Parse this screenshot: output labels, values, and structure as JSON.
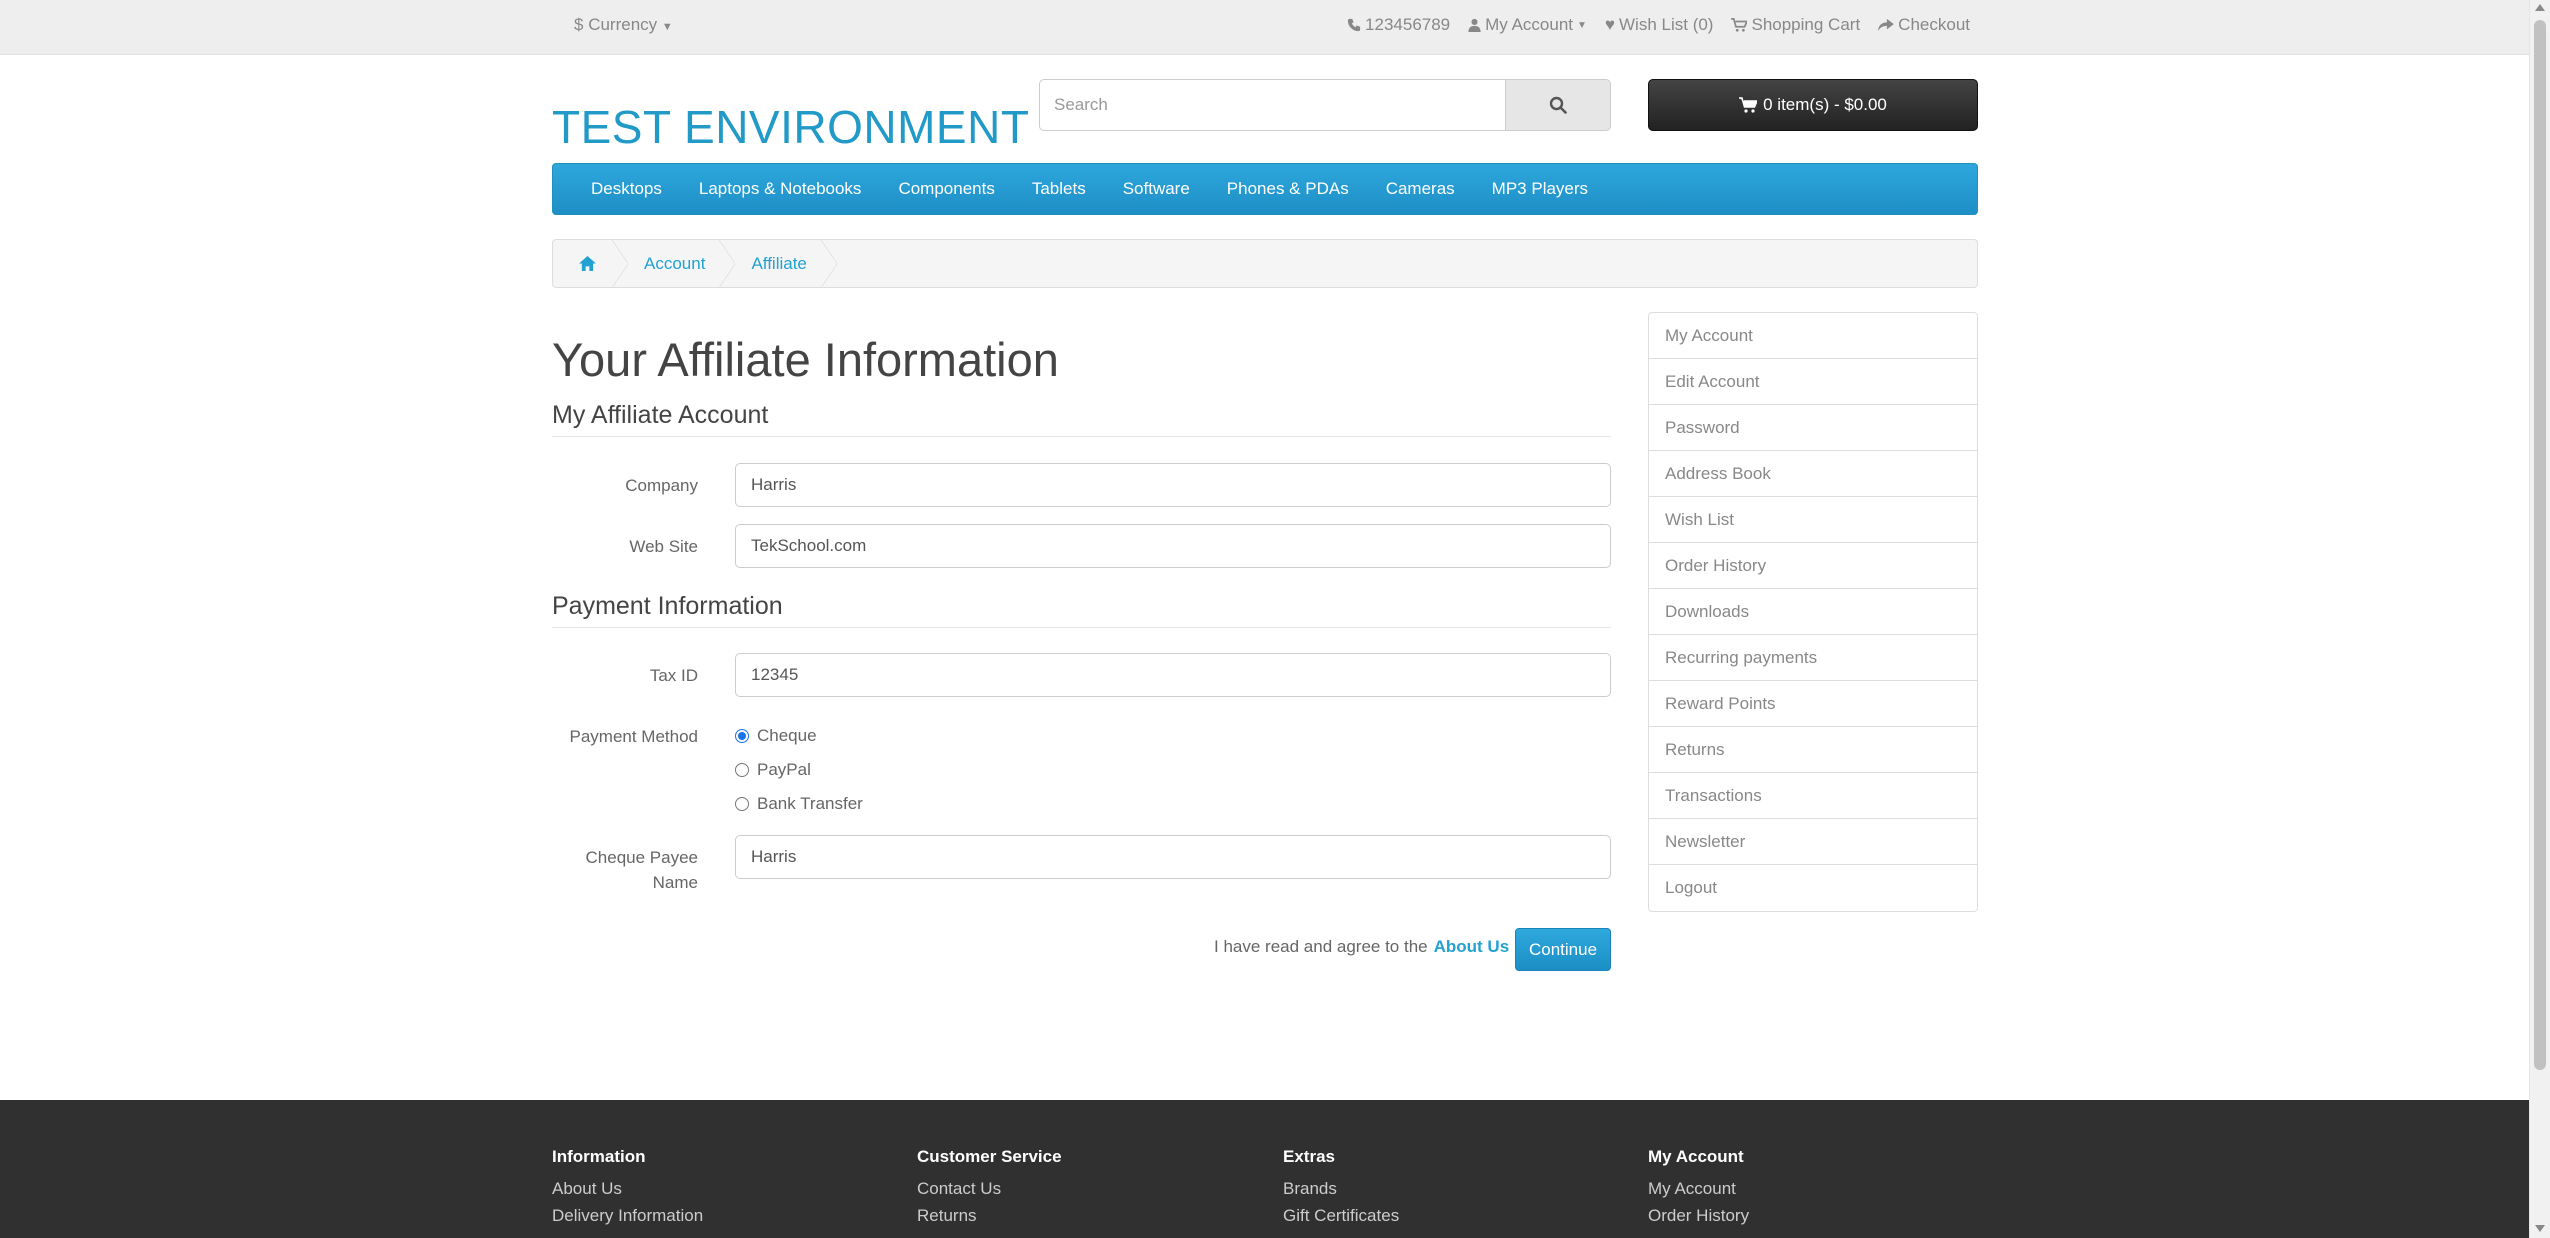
{
  "topbar": {
    "currency_symbol": "$",
    "currency_label": "Currency",
    "phone": "123456789",
    "my_account": "My Account",
    "wish_list": "Wish List (0)",
    "shopping_cart": "Shopping Cart",
    "checkout": "Checkout"
  },
  "header": {
    "logo": "TEST ENVIRONMENT",
    "search_placeholder": "Search",
    "cart_label": "0 item(s) - $0.00"
  },
  "menu": {
    "items": [
      "Desktops",
      "Laptops & Notebooks",
      "Components",
      "Tablets",
      "Software",
      "Phones & PDAs",
      "Cameras",
      "MP3 Players"
    ]
  },
  "breadcrumb": {
    "items": [
      "Account",
      "Affiliate"
    ]
  },
  "page": {
    "title": "Your Affiliate Information",
    "section_account": "My Affiliate Account",
    "company_label": "Company",
    "company_value": "Harris",
    "website_label": "Web Site",
    "website_value": "TekSchool.com",
    "section_payment": "Payment Information",
    "taxid_label": "Tax ID",
    "taxid_value": "12345",
    "payment_method_label": "Payment Method",
    "payment_options": [
      "Cheque",
      "PayPal",
      "Bank Transfer"
    ],
    "payment_selected": "Cheque",
    "cheque_payee_label_1": "Cheque Payee",
    "cheque_payee_label_2": "Name",
    "cheque_payee_value": "Harris",
    "agree_text": "I have read and agree to the",
    "agree_link": "About Us",
    "continue_label": "Continue"
  },
  "sidebar": {
    "items": [
      "My Account",
      "Edit Account",
      "Password",
      "Address Book",
      "Wish List",
      "Order History",
      "Downloads",
      "Recurring payments",
      "Reward Points",
      "Returns",
      "Transactions",
      "Newsletter",
      "Logout"
    ]
  },
  "footer": {
    "information": {
      "title": "Information",
      "links": [
        "About Us",
        "Delivery Information"
      ]
    },
    "customer_service": {
      "title": "Customer Service",
      "links": [
        "Contact Us",
        "Returns"
      ]
    },
    "extras": {
      "title": "Extras",
      "links": [
        "Brands",
        "Gift Certificates"
      ]
    },
    "my_account": {
      "title": "My Account",
      "links": [
        "My Account",
        "Order History"
      ]
    }
  },
  "colors": {
    "accent": "#229ac8",
    "menu_bg": "#229ac8",
    "footer_bg": "#303030"
  }
}
